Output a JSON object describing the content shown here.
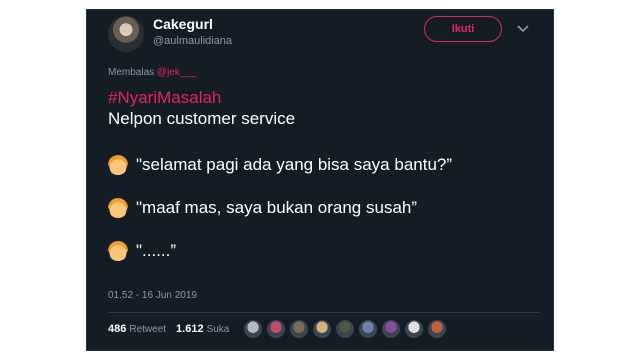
{
  "tweet": {
    "display_name": "Cakegurl",
    "handle": "@aulmaulidiana",
    "follow_label": "Ikuti",
    "reply_prefix": "Membalas",
    "reply_mention": "@jek___",
    "hashtag": "#NyariMasalah",
    "lines": [
      "Nelpon customer service",
      "\"selamat pagi ada yang bisa saya bantu?”",
      "\"maaf mas, saya bukan orang susah”",
      "\"......”"
    ],
    "timestamp": "01.52 - 16 Jun 2019",
    "retweet_count": "486",
    "retweet_label": "Retweet",
    "like_count": "1.612",
    "like_label": "Suka",
    "liker_avatars": [
      {
        "icon": "avatar-1",
        "color": "#b8b8c4"
      },
      {
        "icon": "avatar-2",
        "color": "#c24b6a"
      },
      {
        "icon": "avatar-3",
        "color": "#7d6b5e"
      },
      {
        "icon": "avatar-4",
        "color": "#d8b27a"
      },
      {
        "icon": "avatar-5",
        "color": "#4b5a3a"
      },
      {
        "icon": "avatar-6",
        "color": "#6f7fa8"
      },
      {
        "icon": "avatar-7",
        "color": "#8a4a9a"
      },
      {
        "icon": "avatar-8",
        "color": "#e0e0e0"
      },
      {
        "icon": "avatar-9",
        "color": "#c0603c"
      }
    ]
  },
  "colors": {
    "background": "#141d26",
    "accent": "#e0245e",
    "muted": "#8899a6"
  }
}
